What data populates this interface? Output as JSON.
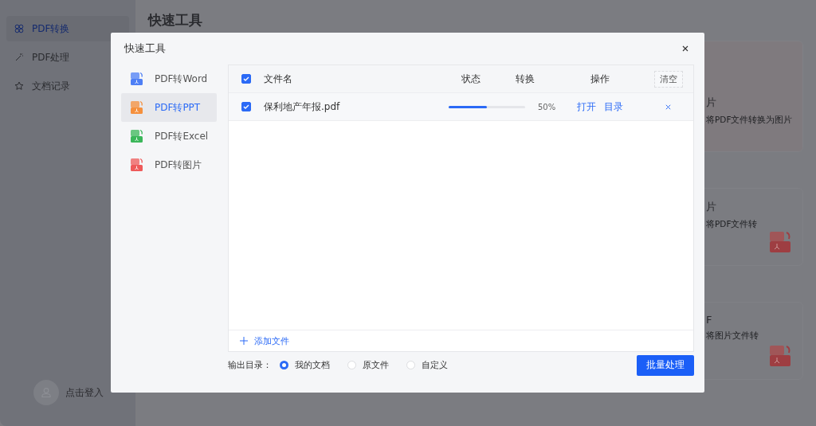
{
  "sidebar": {
    "items": [
      {
        "label": "PDF转换",
        "selected": true
      },
      {
        "label": "PDF处理",
        "selected": false
      },
      {
        "label": "文档记录",
        "selected": false
      }
    ],
    "login": "点击登入"
  },
  "page_title": "快速工具",
  "background_cards": [
    {
      "title_fragment": "片",
      "description": "将PDF文件转换为图片"
    },
    {
      "title_fragment": "片",
      "description": "将PDF文件转"
    },
    {
      "title_fragment": "F",
      "description": "将图片文件转"
    }
  ],
  "dialog": {
    "title": "快速工具",
    "tools": [
      {
        "label": "PDF转Word",
        "color": "#4e7ff5",
        "selected": false
      },
      {
        "label": "PDF转PPT",
        "color": "#f5903d",
        "selected": true
      },
      {
        "label": "PDF转Excel",
        "color": "#3bb75a",
        "selected": false
      },
      {
        "label": "PDF转图片",
        "color": "#ee5a5a",
        "selected": false
      }
    ],
    "table": {
      "select_all": true,
      "columns": [
        "文件名",
        "状态",
        "转换",
        "操作"
      ],
      "clear_button": "清空",
      "rows": [
        {
          "checked": true,
          "name": "保利地产年报.pdf",
          "level": 0.5,
          "percent": "50%",
          "actions": [
            "打开",
            "目录"
          ]
        }
      ],
      "add_file": "添加文件"
    },
    "output_label": "输出目录：",
    "output_options": [
      {
        "label": "我的文档",
        "selected": true
      },
      {
        "label": "原文件",
        "selected": false
      },
      {
        "label": "自定义",
        "selected": false
      }
    ],
    "submit": "批量处理"
  }
}
